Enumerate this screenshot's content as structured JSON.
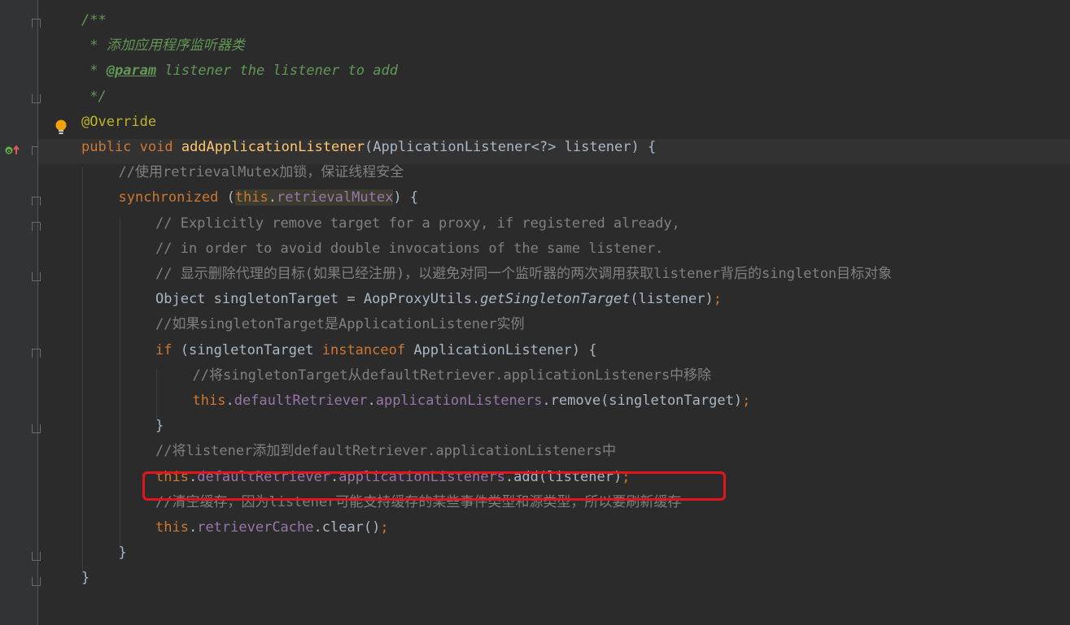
{
  "editor": {
    "lines": [
      {
        "indent": 0,
        "tokens": [
          {
            "c": "doc",
            "t": "/**"
          }
        ]
      },
      {
        "indent": 0,
        "tokens": [
          {
            "c": "doc",
            "t": " * 添加应用程序监听器类"
          }
        ]
      },
      {
        "indent": 0,
        "tokens": [
          {
            "c": "doc",
            "t": " * "
          },
          {
            "c": "doctag",
            "t": "@param"
          },
          {
            "c": "doc",
            "t": " listener the listener to add"
          }
        ]
      },
      {
        "indent": 0,
        "tokens": [
          {
            "c": "doc",
            "t": " */"
          }
        ]
      },
      {
        "indent": 0,
        "tokens": [
          {
            "c": "ann",
            "t": "@Override"
          }
        ]
      },
      {
        "indent": 0,
        "tokens": [
          {
            "c": "kw",
            "t": "public void "
          },
          {
            "c": "fn",
            "t": "addApplicationListener"
          },
          {
            "c": "plain",
            "t": "(ApplicationListener<?> listener) {"
          }
        ]
      },
      {
        "indent": 1,
        "tokens": [
          {
            "c": "cm",
            "t": "//使用retrievalMutex加锁，保证线程安全"
          }
        ]
      },
      {
        "indent": 1,
        "tokens": [
          {
            "c": "kw",
            "t": "synchronized "
          },
          {
            "c": "plain",
            "t": "("
          },
          {
            "c": "kw hl-bg",
            "t": "this"
          },
          {
            "c": "plain hl-bg",
            "t": "."
          },
          {
            "c": "field hl-bg",
            "t": "retrievalMutex"
          },
          {
            "c": "plain",
            "t": ") {"
          }
        ]
      },
      {
        "indent": 2,
        "tokens": [
          {
            "c": "cm",
            "t": "// Explicitly remove target for a proxy, if registered already,"
          }
        ]
      },
      {
        "indent": 2,
        "tokens": [
          {
            "c": "cm",
            "t": "// in order to avoid double invocations of the same listener."
          }
        ]
      },
      {
        "indent": 2,
        "tokens": [
          {
            "c": "cm",
            "t": "// 显示删除代理的目标(如果已经注册)，以避免对同一个监听器的两次调用获取listener背后的singleton目标对象"
          }
        ]
      },
      {
        "indent": 2,
        "tokens": [
          {
            "c": "plain",
            "t": "Object singletonTarget = AopProxyUtils."
          },
          {
            "c": "plain static",
            "t": "getSingletonTarget"
          },
          {
            "c": "plain",
            "t": "(listener)"
          },
          {
            "c": "kw",
            "t": ";"
          }
        ]
      },
      {
        "indent": 2,
        "tokens": [
          {
            "c": "cm",
            "t": "//如果singletonTarget是ApplicationListener实例"
          }
        ]
      },
      {
        "indent": 2,
        "tokens": [
          {
            "c": "kw",
            "t": "if "
          },
          {
            "c": "plain",
            "t": "(singletonTarget "
          },
          {
            "c": "kw",
            "t": "instanceof "
          },
          {
            "c": "plain",
            "t": "ApplicationListener) {"
          }
        ]
      },
      {
        "indent": 3,
        "tokens": [
          {
            "c": "cm",
            "t": "//将singletonTarget从defaultRetriever.applicationListeners中移除"
          }
        ]
      },
      {
        "indent": 3,
        "tokens": [
          {
            "c": "kw",
            "t": "this"
          },
          {
            "c": "plain",
            "t": "."
          },
          {
            "c": "field",
            "t": "defaultRetriever"
          },
          {
            "c": "plain",
            "t": "."
          },
          {
            "c": "field",
            "t": "applicationListeners"
          },
          {
            "c": "plain",
            "t": ".remove(singletonTarget)"
          },
          {
            "c": "kw",
            "t": ";"
          }
        ]
      },
      {
        "indent": 2,
        "tokens": [
          {
            "c": "plain",
            "t": "}"
          }
        ]
      },
      {
        "indent": 2,
        "tokens": [
          {
            "c": "cm",
            "t": "//将listener添加到defaultRetriever.applicationListeners中"
          }
        ]
      },
      {
        "indent": 2,
        "tokens": [
          {
            "c": "kw",
            "t": "this"
          },
          {
            "c": "plain",
            "t": "."
          },
          {
            "c": "field",
            "t": "defaultRetriever"
          },
          {
            "c": "plain",
            "t": "."
          },
          {
            "c": "field",
            "t": "applicationListeners"
          },
          {
            "c": "plain",
            "t": ".add(listener)"
          },
          {
            "c": "kw",
            "t": ";"
          }
        ]
      },
      {
        "indent": 2,
        "tokens": [
          {
            "c": "cm",
            "t": "//清空缓存，因为listener可能支持缓存的某些事件类型和源类型，所以要刷新缓存"
          }
        ]
      },
      {
        "indent": 2,
        "tokens": [
          {
            "c": "kw",
            "t": "this"
          },
          {
            "c": "plain",
            "t": "."
          },
          {
            "c": "field",
            "t": "retrieverCache"
          },
          {
            "c": "plain",
            "t": ".clear()"
          },
          {
            "c": "kw",
            "t": ";"
          }
        ]
      },
      {
        "indent": 1,
        "tokens": [
          {
            "c": "plain",
            "t": "}"
          }
        ]
      },
      {
        "indent": 0,
        "tokens": [
          {
            "c": "plain",
            "t": "}"
          }
        ]
      }
    ]
  },
  "gutter": {
    "bulb_icon": "intention-bulb-icon",
    "override_icon": "overrides-method-icon"
  },
  "colors": {
    "background": "#2b2b2b",
    "gutter": "#313335",
    "highlight_box": "#e0161c"
  }
}
